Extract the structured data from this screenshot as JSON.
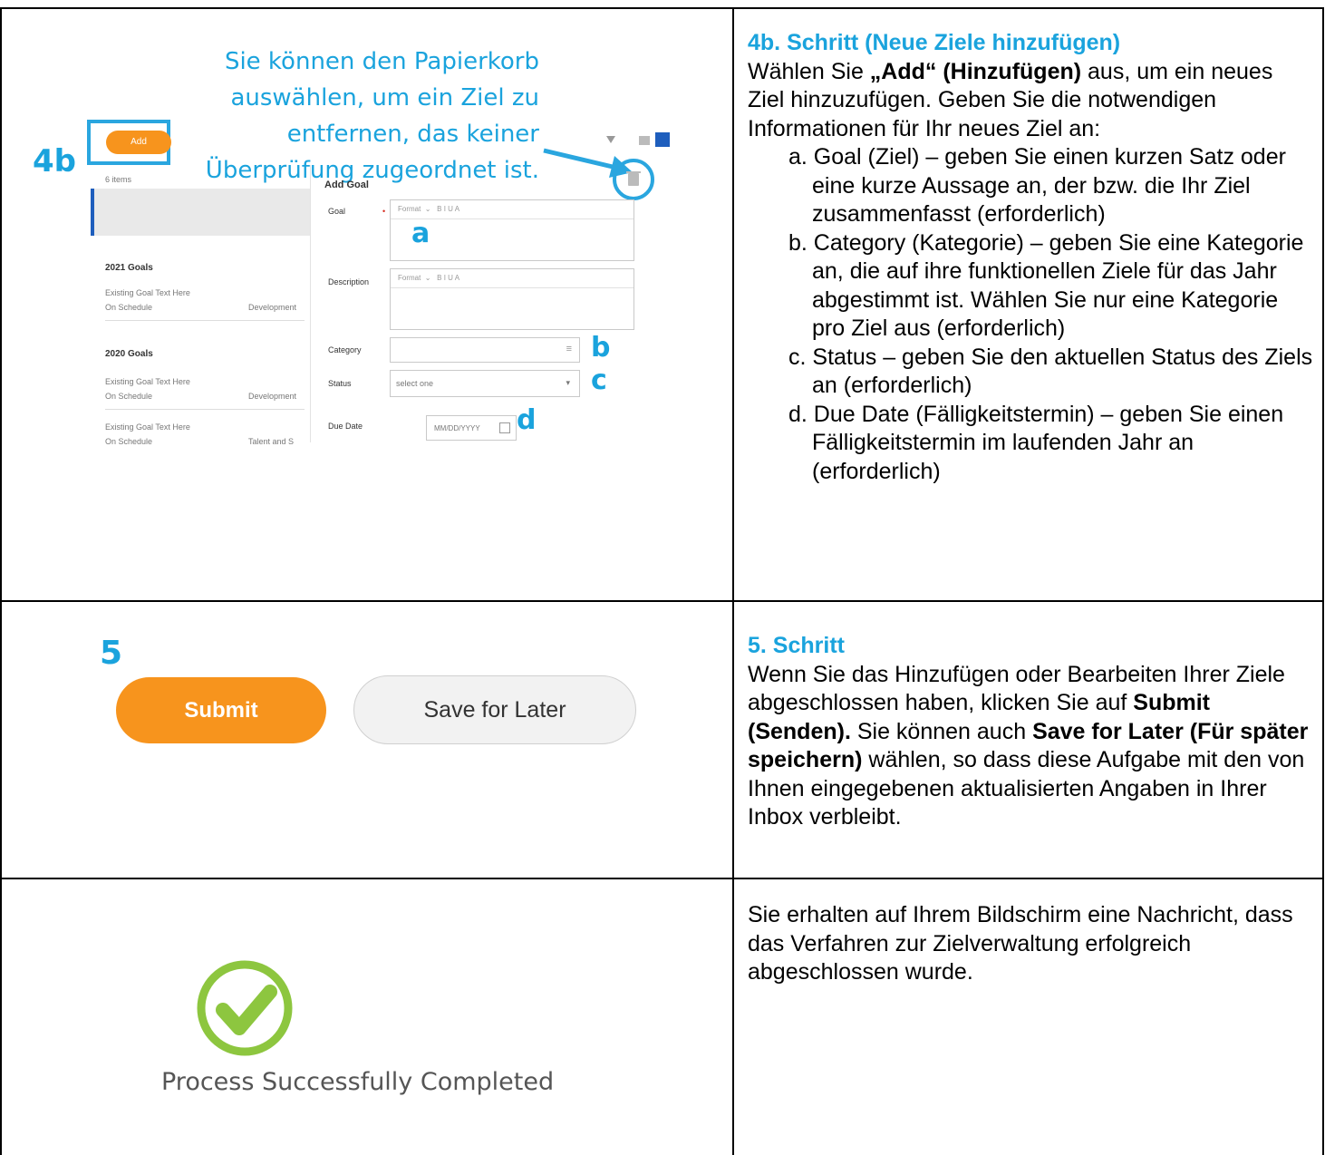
{
  "row1": {
    "callout": {
      "line1": "Sie können den Papierkorb",
      "line2": "auswählen, um ein Ziel zu",
      "line3": "entfernen, das keiner",
      "line4": "Überprüfung zugeordnet ist."
    },
    "step_label": "4b",
    "screenshot": {
      "add_button": "Add",
      "items_count": "6 items",
      "add_goal_heading": "Add Goal",
      "goal_label": "Goal",
      "required_mark": "•",
      "description_label": "Description",
      "category_label": "Category",
      "status_label": "Status",
      "due_date_label": "Due Date",
      "toolbar_format": "Format",
      "toolbar_buttons": "B  I  U  A",
      "status_placeholder": "select one",
      "date_placeholder": "MM/DD/YYYY",
      "section_2021": "2021 Goals",
      "section_2020": "2020 Goals",
      "existing_goal": "Existing Goal Text Here",
      "on_schedule": "On Schedule",
      "development": "Development",
      "talent": "Talent and S",
      "marker_a": "a",
      "marker_b": "b",
      "marker_c": "c",
      "marker_d": "d"
    },
    "title": "4b. Schritt (Neue Ziele hinzufügen)",
    "p1_a": "Wählen Sie ",
    "p1_bold": "„Add“ (Hinzufügen)",
    "p1_b": " aus, um ein neues Ziel hinzuzufügen. Geben Sie die notwendigen Informationen für Ihr neues Ziel an:",
    "items": [
      "a. Goal (Ziel) – geben Sie einen kurzen Satz oder eine kurze Aussage an, der bzw. die Ihr Ziel zusammenfasst (erforderlich)",
      "b. Category (Kategorie) – geben Sie eine Kategorie an, die auf ihre funktionellen Ziele für das Jahr abgestimmt ist. Wählen Sie nur eine Kategorie pro Ziel aus (erforderlich)",
      "c. Status – geben Sie den aktuellen Status des Ziels an (erforderlich)",
      "d. Due Date (Fälligkeitstermin) – geben Sie einen Fälligkeitstermin im laufenden Jahr an (erforderlich)"
    ]
  },
  "row2": {
    "step_label": "5",
    "submit": "Submit",
    "save_later": "Save for Later",
    "title": "5. Schritt",
    "t1": "Wenn Sie das Hinzufügen oder Bearbeiten Ihrer Ziele abgeschlossen haben, klicken Sie auf ",
    "b1": "Submit (Senden).",
    "t2": " Sie können auch ",
    "b2": "Save for Later (Für später speichern)",
    "t3": " wählen, so dass diese Aufgabe mit den von Ihnen eingegebenen aktualisierten Angaben in Ihrer Inbox verbleibt."
  },
  "row3": {
    "completed": "Process Successfully Completed",
    "text": "Sie erhalten auf Ihrem Bildschirm eine Nachricht, dass das Verfahren zur Zielverwaltung erfolgreich abgeschlossen wurde."
  },
  "colors": {
    "accent_blue": "#1aa3dd",
    "orange": "#f7941d",
    "check_green": "#8dc63f"
  }
}
